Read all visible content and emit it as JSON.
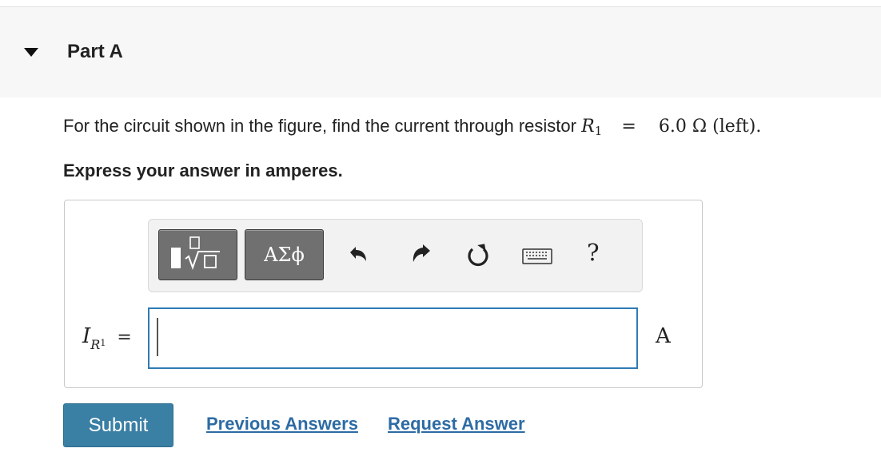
{
  "part": {
    "title": "Part A"
  },
  "question": {
    "text": "For the circuit shown in the figure, find the current through resistor",
    "resistor_symbol": "R",
    "resistor_subscript": "1",
    "equals": "=",
    "resistor_value": "6.0 Ω (left)."
  },
  "instruction": "Express your answer in amperes.",
  "toolbar": {
    "templates_icon": "templates-icon",
    "greek_label": "ΑΣϕ",
    "undo_icon": "undo-icon",
    "redo_icon": "redo-icon",
    "reset_icon": "reset-icon",
    "keyboard_icon": "keyboard-icon",
    "help_label": "?"
  },
  "answer": {
    "variable": "I",
    "variable_sub": "R",
    "variable_sub_sub": "1",
    "equals": "=",
    "value": "",
    "unit": "A"
  },
  "actions": {
    "submit_label": "Submit",
    "previous_answers_label": "Previous Answers",
    "request_answer_label": "Request Answer"
  },
  "colors": {
    "header_bg": "#f7f7f7",
    "submit_bg": "#3a7fa4",
    "link": "#2d6ba4",
    "input_border": "#2f7bb5",
    "toolbar_button": "#707070"
  }
}
